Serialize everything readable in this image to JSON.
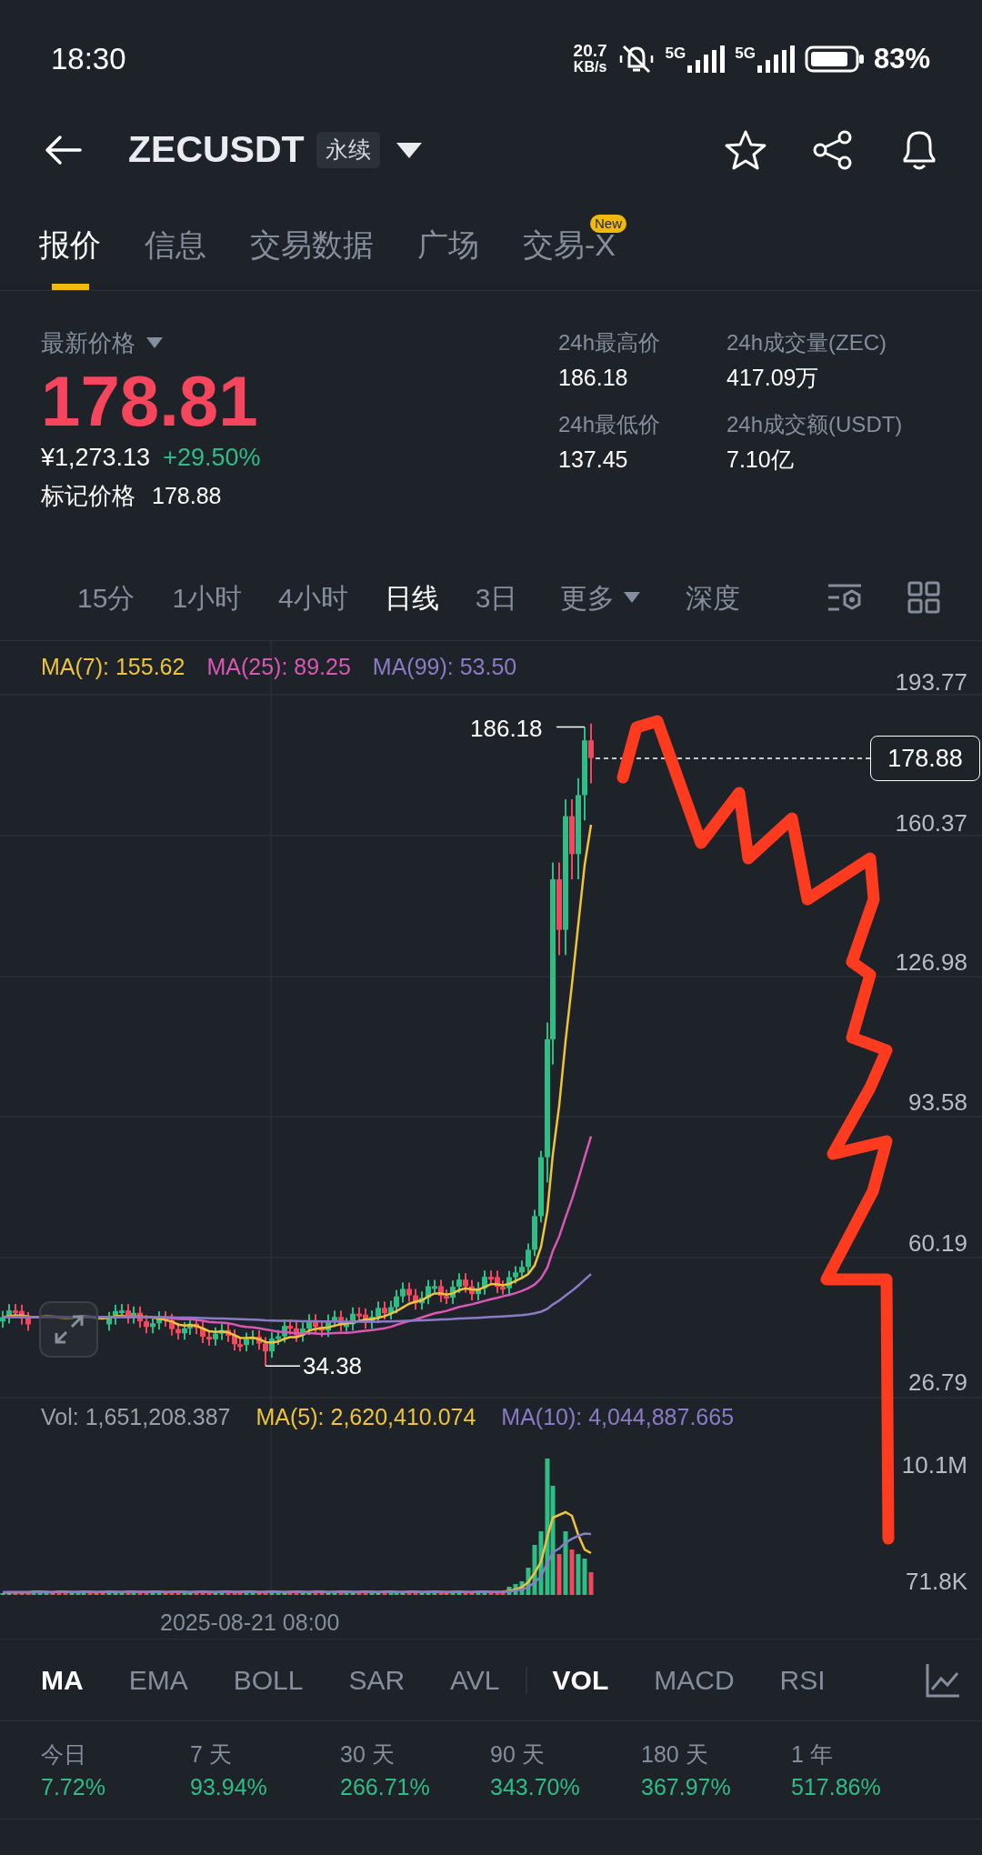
{
  "status_bar": {
    "time": "18:30",
    "speed": "20.7",
    "speed_unit": "KB/s",
    "networks": [
      "5G",
      "5G"
    ],
    "battery": "83%"
  },
  "header": {
    "title": "ZECUSDT",
    "badge": "永续"
  },
  "tabs": [
    {
      "label": "报价",
      "selected": true
    },
    {
      "label": "信息",
      "selected": false
    },
    {
      "label": "交易数据",
      "selected": false
    },
    {
      "label": "广场",
      "selected": false
    },
    {
      "label": "交易-X",
      "selected": false,
      "badge": "New"
    }
  ],
  "price": {
    "label": "最新价格",
    "last": "178.81",
    "cny": "¥1,273.13",
    "change": "+29.50%",
    "mark_label": "标记价格",
    "mark": "178.88"
  },
  "stats_24h": [
    {
      "label": "24h最高价",
      "value": "186.18"
    },
    {
      "label": "24h成交量(ZEC)",
      "value": "417.09万"
    },
    {
      "label": "24h最低价",
      "value": "137.45"
    },
    {
      "label": "24h成交额(USDT)",
      "value": "7.10亿"
    }
  ],
  "intervals": [
    {
      "label": "15分",
      "kind": "tab",
      "selected": false
    },
    {
      "label": "1小时",
      "kind": "tab",
      "selected": false
    },
    {
      "label": "4小时",
      "kind": "tab",
      "selected": false
    },
    {
      "label": "日线",
      "kind": "tab",
      "selected": true
    },
    {
      "label": "3日",
      "kind": "tab",
      "selected": false
    },
    {
      "label": "更多",
      "kind": "menu",
      "selected": false
    },
    {
      "label": "深度",
      "kind": "tab",
      "selected": false
    }
  ],
  "chart": {
    "ma_legend": [
      {
        "text": "MA(7): 155.62",
        "color": "#f0c43a"
      },
      {
        "text": "MA(25): 89.25",
        "color": "#d957b5"
      },
      {
        "text": "MA(99): 53.50",
        "color": "#8b7bc7"
      }
    ],
    "price_axis": [
      "193.77",
      "160.37",
      "126.98",
      "93.58",
      "60.19",
      "26.79"
    ],
    "current_price": "178.88",
    "high_label": "186.18",
    "low_label": "34.38",
    "volume_legend": [
      {
        "text": "Vol: 1,651,208.387",
        "color": "#9aa1ac"
      },
      {
        "text": "MA(5): 2,620,410.074",
        "color": "#f0c43a"
      },
      {
        "text": "MA(10): 4,044,887.665",
        "color": "#8b7bc7"
      }
    ],
    "volume_axis": [
      "10.1M",
      "71.8K"
    ],
    "time_label": "2025-08-21 08:00"
  },
  "main_indicators": [
    {
      "label": "MA",
      "selected": true
    },
    {
      "label": "EMA",
      "selected": false
    },
    {
      "label": "BOLL",
      "selected": false
    },
    {
      "label": "SAR",
      "selected": false
    },
    {
      "label": "AVL",
      "selected": false
    }
  ],
  "sub_indicators": [
    {
      "label": "VOL",
      "selected": true
    },
    {
      "label": "MACD",
      "selected": false
    },
    {
      "label": "RSI",
      "selected": false
    }
  ],
  "performance": [
    {
      "label": "今日",
      "value": "7.72%"
    },
    {
      "label": "7 天",
      "value": "93.94%"
    },
    {
      "label": "30 天",
      "value": "266.71%"
    },
    {
      "label": "90 天",
      "value": "343.70%"
    },
    {
      "label": "180 天",
      "value": "367.97%"
    },
    {
      "label": "1 年",
      "value": "517.86%"
    }
  ]
}
